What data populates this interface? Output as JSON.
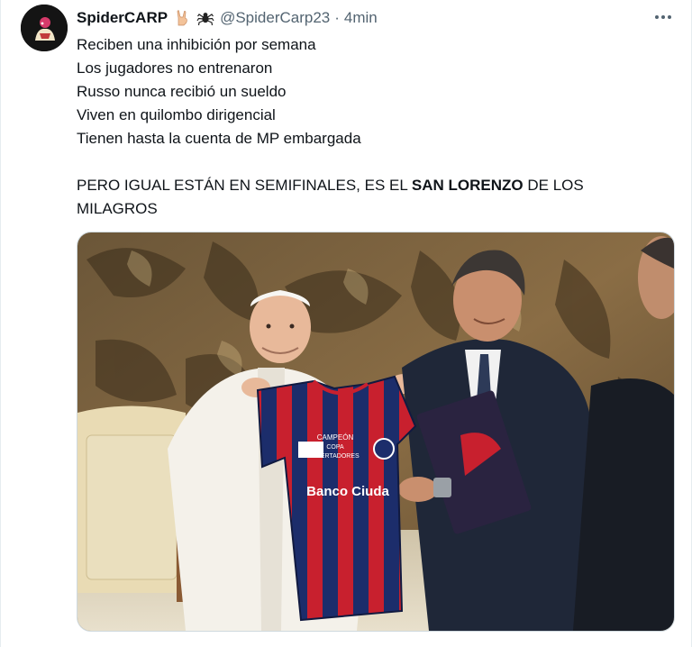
{
  "tweet": {
    "display_name": "SpiderCARP",
    "handle": "@SpiderCarp23",
    "separator": "·",
    "time": "4min",
    "avatar_icon": "avatar-icon",
    "name_emojis": [
      "rock-hand-icon",
      "spider-icon"
    ],
    "more_icon": "more-icon",
    "lines": [
      "Reciben una inhibición por semana",
      "Los jugadores no entrenaron",
      "Russo nunca recibió un sueldo",
      "Viven en quilombo dirigencial",
      "Tienen hasta la cuenta de MP embargada"
    ],
    "closing_prefix": "PERO IGUAL ESTÁN EN SEMIFINALES, ES EL ",
    "closing_bold": "SAN LORENZO",
    "closing_suffix": " DE LOS",
    "closing_line2": "MILAGROS"
  },
  "media": {
    "jersey_text_1": "CAMPEÓN",
    "jersey_text_2": "COPA",
    "jersey_text_3": "LIBERTADORES",
    "jersey_sponsor": "Banco Ciuda"
  },
  "colors": {
    "text": "#0f1419",
    "secondary": "#536471",
    "border": "#cfd9de",
    "jersey_red": "#c8202e",
    "jersey_blue": "#1c2d6b"
  }
}
